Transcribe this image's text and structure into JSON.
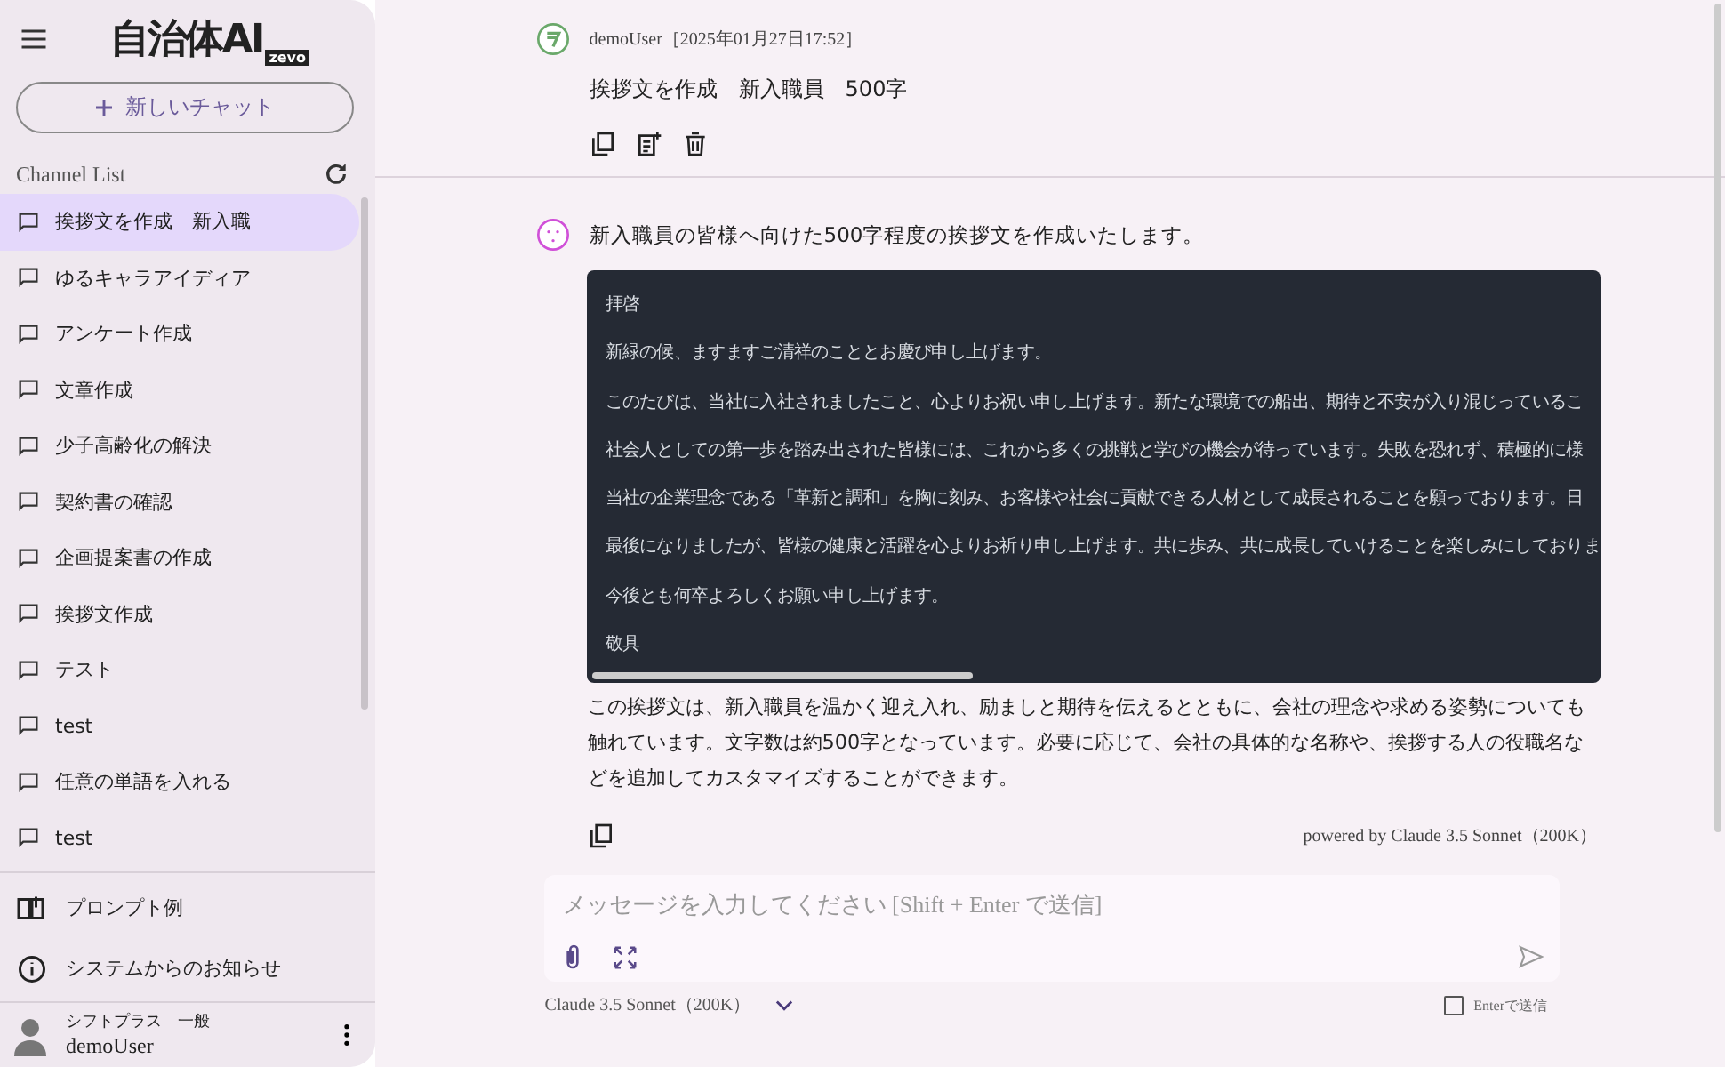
{
  "sidebar": {
    "logo": {
      "main": "自治体AI",
      "sub": "zevo"
    },
    "new_chat_button": "新しいチャット",
    "channel_list_title": "Channel List",
    "channels": [
      {
        "label": "挨拶文を作成　新入職",
        "selected": true
      },
      {
        "label": "ゆるキャラアイディア",
        "selected": false
      },
      {
        "label": "アンケート作成",
        "selected": false
      },
      {
        "label": "文章作成",
        "selected": false
      },
      {
        "label": "少子高齢化の解決",
        "selected": false
      },
      {
        "label": "契約書の確認",
        "selected": false
      },
      {
        "label": "企画提案書の作成",
        "selected": false
      },
      {
        "label": "挨拶文作成",
        "selected": false
      },
      {
        "label": "テスト",
        "selected": false
      },
      {
        "label": "test",
        "selected": false
      },
      {
        "label": "任意の単語を入れる",
        "selected": false
      },
      {
        "label": "test",
        "selected": false
      }
    ],
    "bottom_links": [
      {
        "kind": "book",
        "label": "プロンプト例"
      },
      {
        "kind": "info",
        "label": "システムからのお知らせ"
      }
    ],
    "user": {
      "org": "シフトプラス　一般",
      "name": "demoUser"
    }
  },
  "chat": {
    "user_message": {
      "author": "demoUser",
      "timestamp": "［2025年01月27日17:52］",
      "text": "挨拶文を作成　新入職員　500字"
    },
    "ai_message": {
      "intro": "新入職員の皆様へ向けた500字程度の挨拶文を作成いたします。",
      "code_lines": [
        "拝啓",
        "新緑の候、ますますご清祥のこととお慶び申し上げます。",
        "このたびは、当社に入社されましたこと、心よりお祝い申し上げます。新たな環境での船出、期待と不安が入り混じっているこ",
        "社会人としての第一歩を踏み出された皆様には、これから多くの挑戦と学びの機会が待っています。失敗を恐れず、積極的に様",
        "当社の企業理念である「革新と調和」を胸に刻み、お客様や社会に貢献できる人材として成長されることを願っております。日",
        "最後になりましたが、皆様の健康と活躍を心よりお祈り申し上げます。共に歩み、共に成長していけることを楽しみにしておりま",
        "今後とも何卒よろしくお願い申し上げます。",
        "敬具"
      ],
      "outro": "この挨拶文は、新入職員を温かく迎え入れ、励ましと期待を伝えるとともに、会社の理念や求める姿勢についても触れています。文字数は約500字となっています。必要に応じて、会社の具体的な名称や、挨拶する人の役職名などを追加してカスタマイズすることができます。",
      "powered_by": "powered by Claude 3.5 Sonnet（200K）"
    }
  },
  "input": {
    "placeholder": "メッセージを入力してください [Shift + Enter で送信]",
    "model": "Claude 3.5 Sonnet（200K）",
    "enter_to_send": {
      "label": "Enterで送信",
      "checked": false
    }
  }
}
